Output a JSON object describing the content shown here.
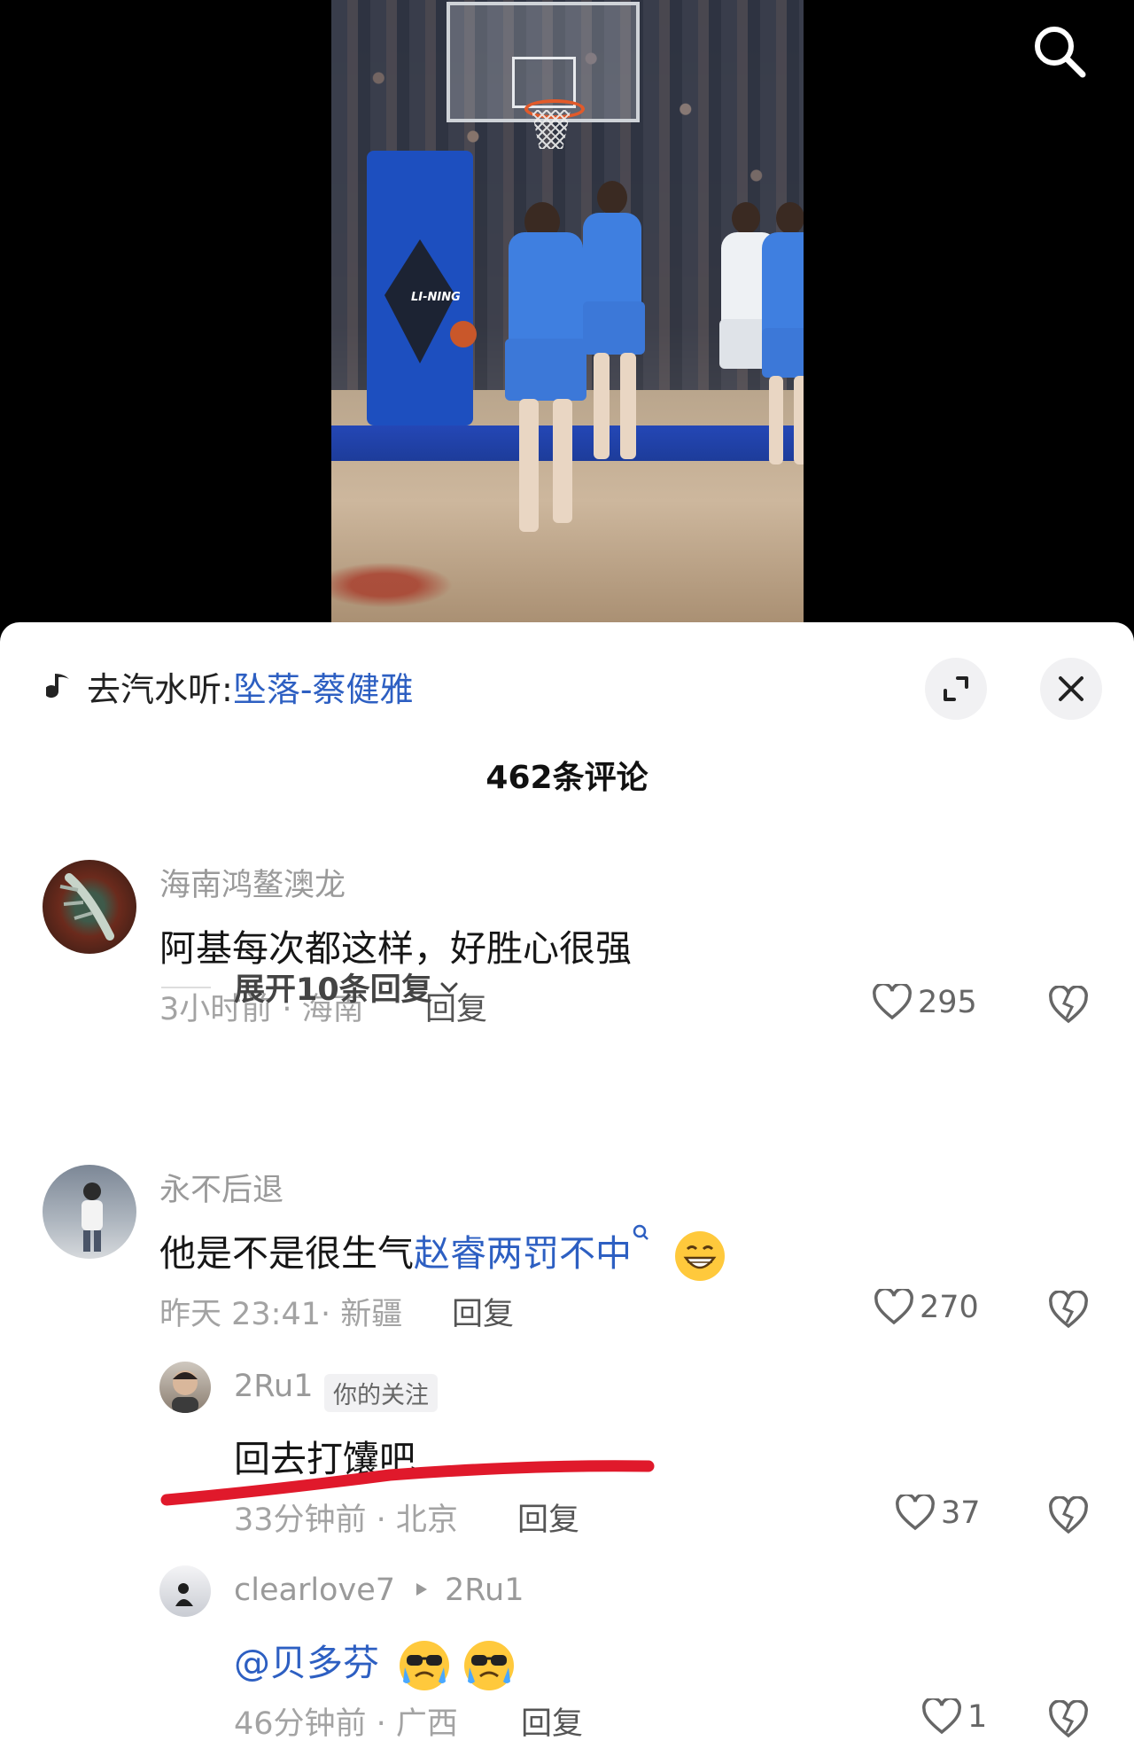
{
  "video": {
    "brand_text": "LI-NING"
  },
  "search_icon": "search-icon",
  "sheet": {
    "music_prefix": "去汽水听:",
    "music_title": "坠落-蔡健雅",
    "comment_count": "462条评论",
    "comments": [
      {
        "user": "海南鸿鳌澳龙",
        "text": "阿基每次都这样，好胜心很强",
        "meta": "3小时前 · 海南",
        "reply": "回复",
        "likes": "295",
        "expand": "展开10条回复"
      },
      {
        "user": "永不后退",
        "text_plain": "他是不是很生气",
        "text_link": "赵睿两罚不中",
        "meta": "昨天 23:41· 新疆",
        "reply": "回复",
        "likes": "270",
        "replies": [
          {
            "user": "2Ru1",
            "tag": "你的关注",
            "text": "回去打馕吧",
            "meta": "33分钟前 · 北京",
            "reply": "回复",
            "likes": "37"
          },
          {
            "user": "clearlove7",
            "reply_to": "2Ru1",
            "text": "@贝多芬",
            "meta": "46分钟前 · 广西",
            "reply": "回复",
            "likes": "1"
          }
        ]
      }
    ]
  },
  "colors": {
    "link": "#2d5fc2",
    "highlight": "#e0192b"
  }
}
